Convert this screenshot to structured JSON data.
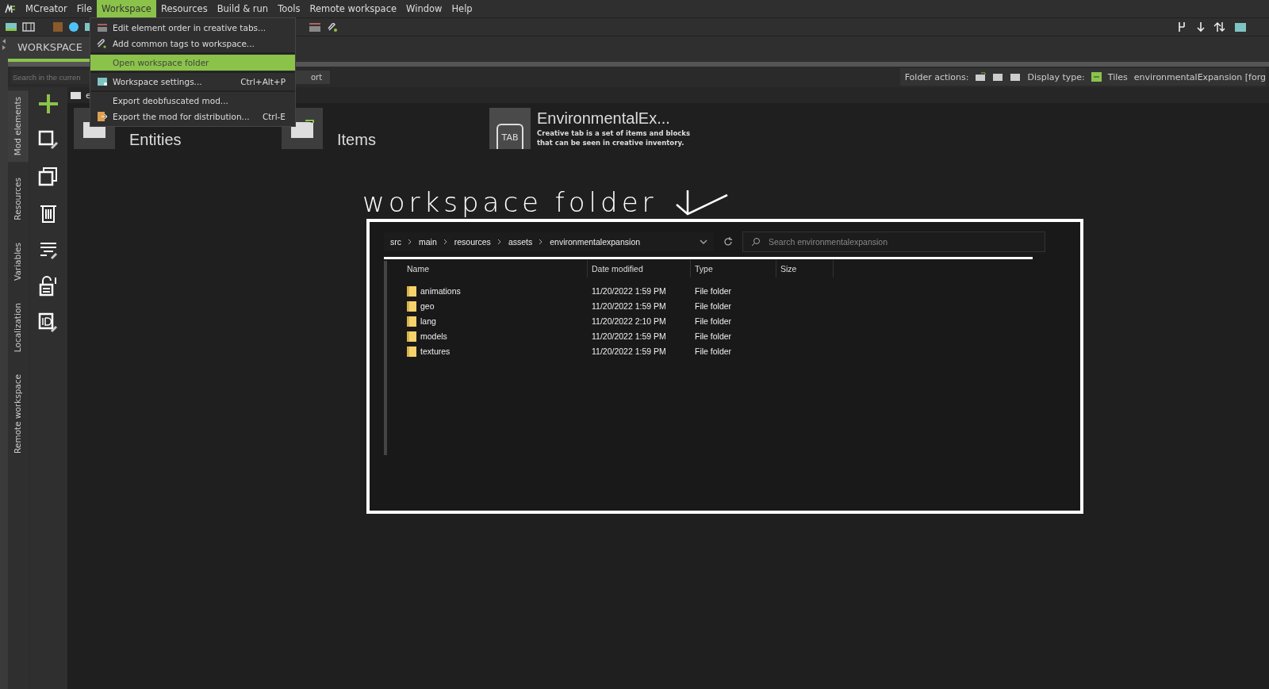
{
  "menu_bar": [
    {
      "label": "MCreator",
      "selected": false
    },
    {
      "label": "File",
      "selected": false
    },
    {
      "label": "Workspace",
      "selected": true
    },
    {
      "label": "Resources",
      "selected": false
    },
    {
      "label": "Build & run",
      "selected": false
    },
    {
      "label": "Tools",
      "selected": false
    },
    {
      "label": "Remote workspace",
      "selected": false
    },
    {
      "label": "Window",
      "selected": false
    },
    {
      "label": "Help",
      "selected": false
    }
  ],
  "workspace_menu": [
    [
      {
        "label": "Edit element order in creative tabs...",
        "selected": false
      },
      {
        "label": "Add common tags to workspace...",
        "selected": false
      }
    ],
    [
      {
        "label": "Open workspace folder",
        "selected": true
      }
    ],
    [
      {
        "label": "Workspace settings...",
        "shortcut": "Ctrl+Alt+P",
        "selected": false
      }
    ],
    [
      {
        "label": "Export deobfuscated mod...",
        "selected": false
      },
      {
        "label": "Export the mod for distribution...",
        "shortcut": "Ctrl-E",
        "selected": false
      }
    ]
  ],
  "tabs": [
    {
      "label": "WORKSPACE",
      "selected": true
    }
  ],
  "search": {
    "placeholder": "Search in the curren"
  },
  "partial_button": "ort",
  "folder_bar": {
    "folder_actions": "Folder actions:",
    "display_type": "Display type:",
    "display_value": "Tiles",
    "workspace": "environmentalExpansion [forg"
  },
  "breadcrumb": "e",
  "side_tabs": [
    {
      "label": "Mod elements",
      "selected": true
    },
    {
      "label": "Resources",
      "selected": false
    },
    {
      "label": "Variables",
      "selected": false
    },
    {
      "label": "Localization",
      "selected": false
    },
    {
      "label": "Remote workspace",
      "selected": false
    }
  ],
  "tiles": [
    {
      "kind": "folder",
      "title": "Entities"
    },
    {
      "kind": "folder",
      "title": "Items"
    },
    {
      "kind": "tab",
      "title": "EnvironmentalEx...",
      "badge": "TAB",
      "description": "Creative tab is a set of items and blocks that can be seen in creative inventory."
    }
  ],
  "annotation": "workspace folder",
  "explorer": {
    "path": [
      "src",
      "main",
      "resources",
      "assets",
      "environmentalexpansion"
    ],
    "search_placeholder": "Search environmentalexpansion",
    "columns": [
      "Name",
      "Date modified",
      "Type",
      "Size"
    ],
    "rows": [
      {
        "name": "animations",
        "date": "11/20/2022 1:59 PM",
        "type": "File folder"
      },
      {
        "name": "geo",
        "date": "11/20/2022 1:59 PM",
        "type": "File folder"
      },
      {
        "name": "lang",
        "date": "11/20/2022 2:10 PM",
        "type": "File folder"
      },
      {
        "name": "models",
        "date": "11/20/2022 1:59 PM",
        "type": "File folder"
      },
      {
        "name": "textures",
        "date": "11/20/2022 1:59 PM",
        "type": "File folder"
      }
    ]
  }
}
